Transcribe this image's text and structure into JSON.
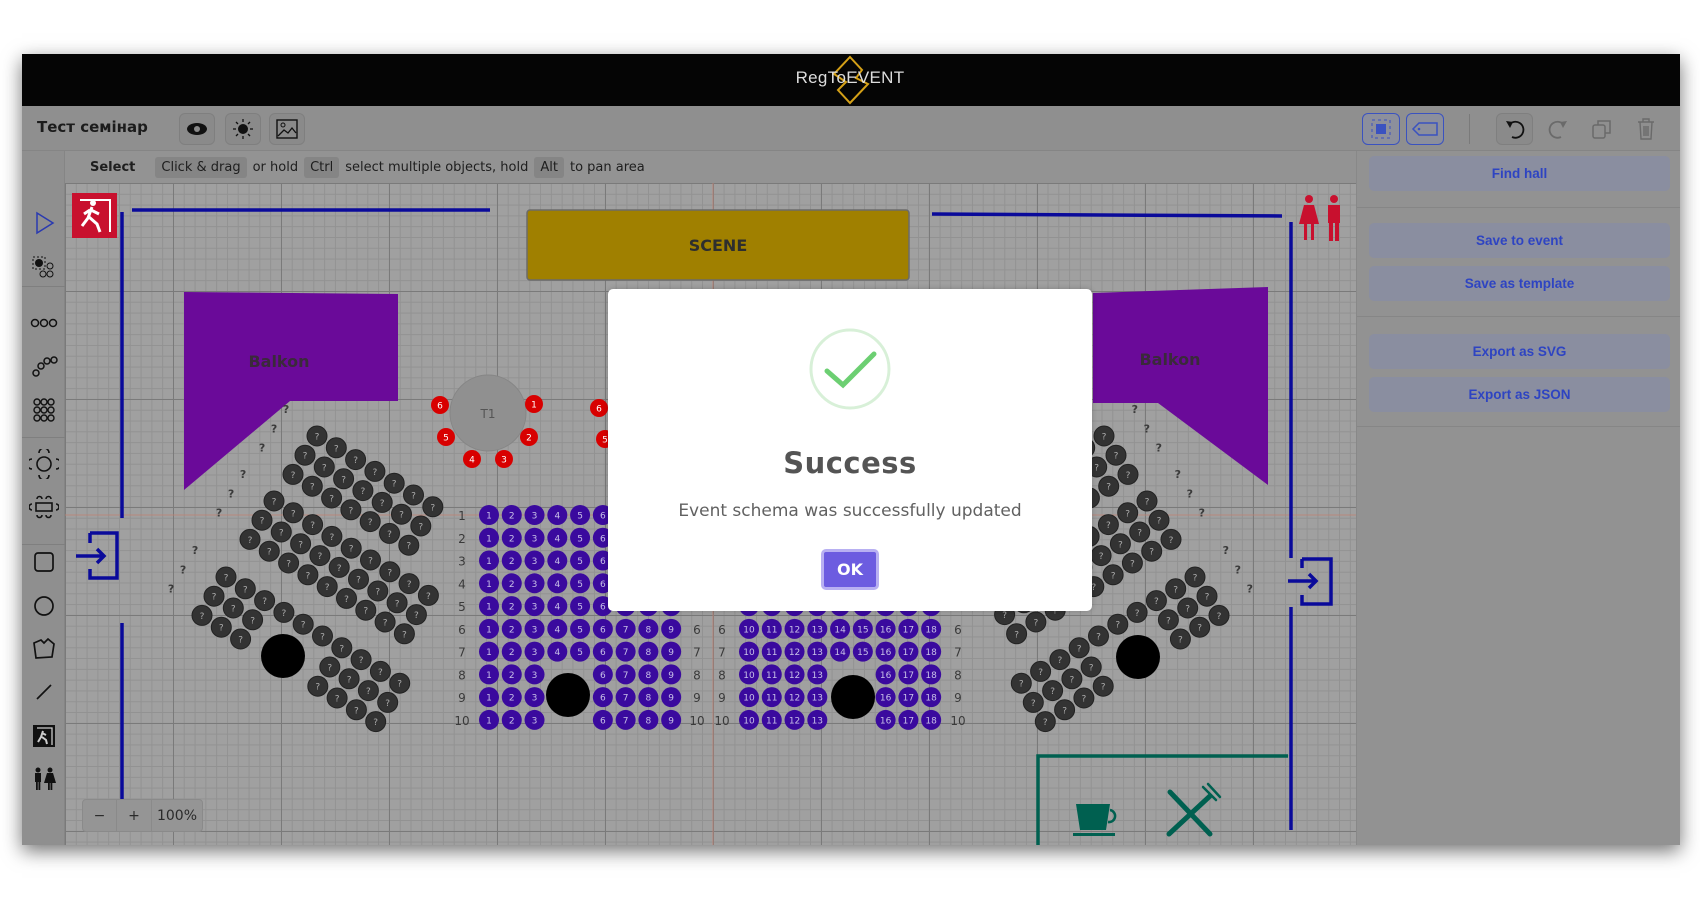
{
  "header": {
    "logo_text": "RegToEVENT",
    "logo_color": "#d4a017"
  },
  "toolbar": {
    "title": "Тест семінар",
    "left_icons": [
      "eye-icon",
      "sun-icon",
      "image-icon"
    ],
    "right_icons": [
      "select-area-icon",
      "tag-icon",
      "undo-icon",
      "redo-icon",
      "copy-icon",
      "trash-icon"
    ]
  },
  "hint": {
    "mode": "Select",
    "k1": "Click & drag",
    "t1": "or hold",
    "k2": "Ctrl",
    "t2": "select multiple objects,  hold",
    "k3": "Alt",
    "t3": "to pan area"
  },
  "tools": [
    "pointer-icon",
    "seat-select-icon",
    "row-icon",
    "curved-row-icon",
    "seat-grid-icon",
    "round-table-icon",
    "rect-table-icon",
    "rectangle-icon",
    "circle-icon",
    "polygon-icon",
    "line-icon",
    "exit-icon",
    "wc-icon"
  ],
  "panel": {
    "find_hall": "Find hall",
    "save_event": "Save to event",
    "save_template": "Save as template",
    "export_svg": "Export as SVG",
    "export_json": "Export as JSON"
  },
  "zoom": {
    "minus": "−",
    "plus": "+",
    "level": "100%"
  },
  "canvas": {
    "scene_label": "SCENE",
    "balkon_left": "Balkon",
    "balkon_right": "Balkon",
    "table_label": "T1",
    "table_seats": [
      "1",
      "2",
      "3",
      "4",
      "5",
      "6"
    ],
    "unassigned_label": "?",
    "sections": [
      {
        "rows": [
          "1",
          "2",
          "3",
          "4",
          "5",
          "6",
          "7",
          "8",
          "9",
          "10"
        ],
        "seats": [
          1,
          2,
          3,
          4,
          5,
          6,
          7,
          8,
          9
        ],
        "missing": {
          "8": [
            4,
            5
          ],
          "9": [
            4,
            5
          ],
          "10": [
            4,
            5
          ]
        }
      },
      {
        "rows": [
          "1",
          "2",
          "3",
          "4",
          "5",
          "6",
          "7",
          "8",
          "9",
          "10"
        ],
        "seats": [
          10,
          11,
          12,
          13,
          14,
          15,
          16,
          17,
          18
        ],
        "missing": {
          "8": [
            14,
            15
          ],
          "9": [
            14,
            15
          ],
          "10": [
            14,
            15
          ]
        }
      }
    ]
  },
  "colors": {
    "wall": "#0a0a9a",
    "balkon": "#6a0a99",
    "scene": "#a08000",
    "seat": "#3a0a9e",
    "table_seat": "#d80000",
    "cafe": "#006050",
    "exit": "#c8102e",
    "accent": "#6c5ce0",
    "success": "#6ccf72"
  },
  "modal": {
    "title": "Success",
    "message": "Event schema was successfully updated",
    "ok": "OK"
  }
}
